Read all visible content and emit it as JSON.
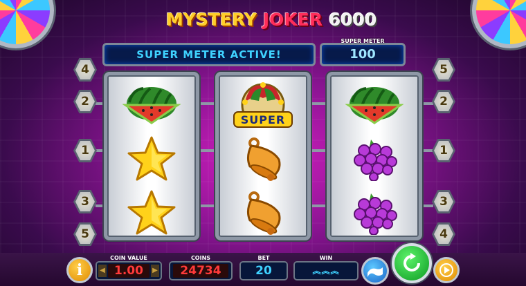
{
  "logo": {
    "word1": "MYSTERY",
    "word2": "JOKER",
    "word3": "6000"
  },
  "message": {
    "text": "SUPER METER ACTIVE!"
  },
  "super_meter": {
    "label": "SUPER METER",
    "value": "100"
  },
  "reels": [
    {
      "symbols": [
        "watermelon",
        "star",
        "star"
      ]
    },
    {
      "symbols": [
        "super-joker",
        "bell",
        "bell"
      ]
    },
    {
      "symbols": [
        "watermelon",
        "grapes",
        "grapes"
      ]
    }
  ],
  "paylines": {
    "left": [
      "4",
      "2",
      "1",
      "3",
      "5"
    ],
    "right": [
      "5",
      "2",
      "1",
      "3",
      "4"
    ]
  },
  "bottom": {
    "coin_value_label": "COIN VALUE",
    "coin_value": "1.00",
    "coins_label": "COINS",
    "coins": "24734",
    "bet_label": "BET",
    "bet": "20",
    "win_label": "WIN",
    "win_chevrons": "︽︽︽"
  },
  "super_label": "SUPER",
  "info_label": "i",
  "colors": {
    "accent": "#3fd2ff",
    "spin": "#1fc83a",
    "gold": "#f0a000",
    "magenta": "#d21fbf"
  }
}
